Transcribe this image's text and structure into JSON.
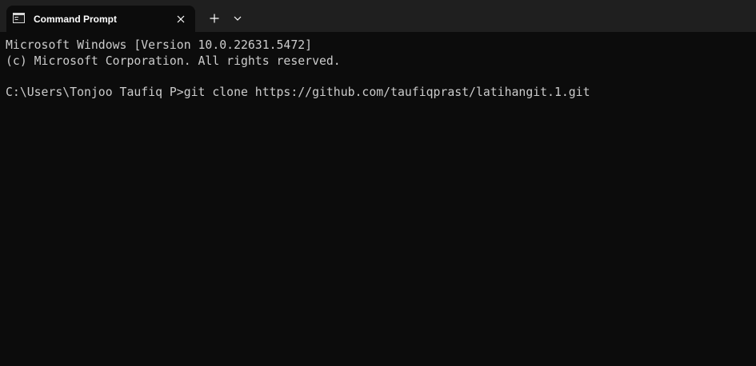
{
  "tab": {
    "title": "Command Prompt",
    "icon": "command-prompt-icon",
    "close_icon": "close-icon"
  },
  "tabbar": {
    "new_tab_icon": "plus-icon",
    "dropdown_icon": "chevron-down-icon"
  },
  "terminal": {
    "lines": [
      "Microsoft Windows [Version 10.0.22631.5472]",
      "(c) Microsoft Corporation. All rights reserved.",
      "",
      "C:\\Users\\Tonjoo Taufiq P>git clone https://github.com/taufiqprast/latihangit.1.git"
    ]
  },
  "colors": {
    "tabbar_bg": "#1f1f1f",
    "terminal_bg": "#0c0c0c",
    "terminal_text": "#cccccc",
    "tab_text": "#ffffff"
  }
}
